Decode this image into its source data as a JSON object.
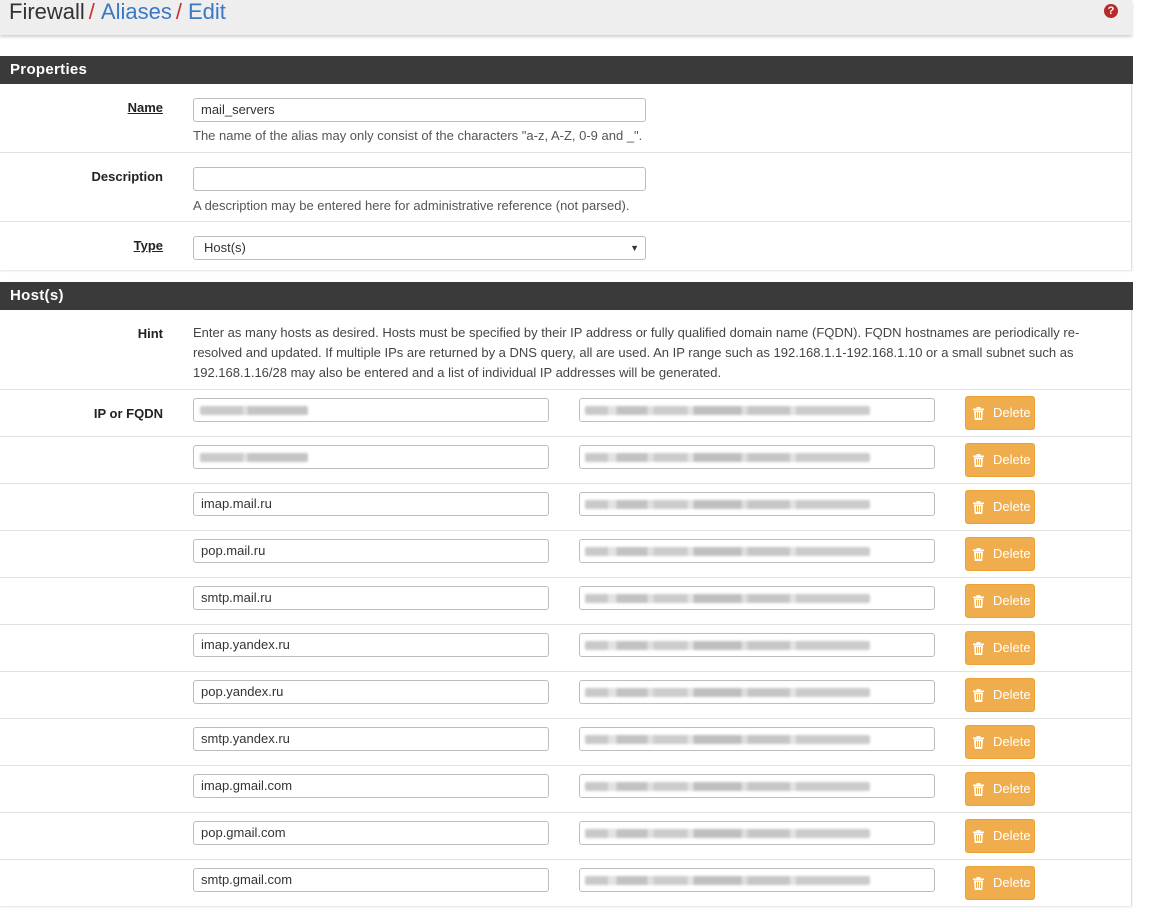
{
  "breadcrumb": {
    "root": "Firewall",
    "aliases": "Aliases",
    "edit": "Edit",
    "help_icon": "question-circle-icon"
  },
  "properties": {
    "title": "Properties",
    "name_label": "Name",
    "name_value": "mail_servers",
    "name_help": "The name of the alias may only consist of the characters \"a-z, A-Z, 0-9 and _\".",
    "description_label": "Description",
    "description_value": "",
    "description_help": "A description may be entered here for administrative reference (not parsed).",
    "type_label": "Type",
    "type_value": "Host(s)"
  },
  "hosts": {
    "title": "Host(s)",
    "hint_label": "Hint",
    "hint_text": "Enter as many hosts as desired. Hosts must be specified by their IP address or fully qualified domain name (FQDN). FQDN hostnames are periodically re-resolved and updated. If multiple IPs are returned by a DNS query, all are used. An IP range such as 192.168.1.1-192.168.1.10 or a small subnet such as 192.168.1.16/28 may also be entered and a list of individual IP addresses will be generated.",
    "ip_label": "IP or FQDN",
    "delete_label": "Delete",
    "delete_icon": "trash-icon",
    "entries": [
      {
        "host": "",
        "obscured": true
      },
      {
        "host": "",
        "obscured": true
      },
      {
        "host": "imap.mail.ru",
        "obscured": false
      },
      {
        "host": "pop.mail.ru",
        "obscured": false
      },
      {
        "host": "smtp.mail.ru",
        "obscured": false
      },
      {
        "host": "imap.yandex.ru",
        "obscured": false
      },
      {
        "host": "pop.yandex.ru",
        "obscured": false
      },
      {
        "host": "smtp.yandex.ru",
        "obscured": false
      },
      {
        "host": "imap.gmail.com",
        "obscured": false
      },
      {
        "host": "pop.gmail.com",
        "obscured": false
      },
      {
        "host": "smtp.gmail.com",
        "obscured": false
      }
    ]
  },
  "colors": {
    "header_bg": "#3a3a3a",
    "link": "#3b78c3",
    "separator": "#c9302c",
    "delete_button": "#f0ad4e"
  }
}
